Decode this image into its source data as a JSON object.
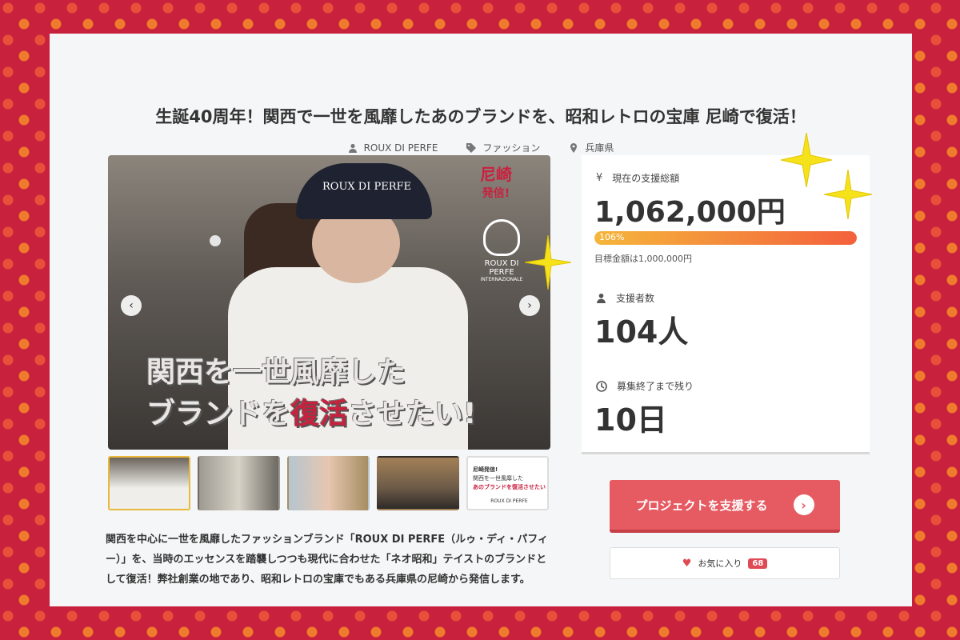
{
  "project": {
    "title": "生誕40周年！関西で一世を風靡したあのブランドを、昭和レトロの宝庫 尼崎で復活！",
    "meta": {
      "owner": "ROUX DI PERFE",
      "category": "ファッション",
      "location": "兵庫県"
    }
  },
  "hero": {
    "cap_text": "ROUX DI PERFE",
    "badge_line1": "尼崎",
    "badge_line2": "発信!",
    "logo_text": "ROUX DI PERFE",
    "logo_sub": "INTERNAZIONALE",
    "headline_line1": "関西を一世風靡した",
    "headline_line2_pre": "ブランドを",
    "headline_line2_accent": "復活",
    "headline_line2_post": "させたい!",
    "prev_arrow": "‹",
    "next_arrow": "›"
  },
  "thumbnails": [
    {
      "id": "thumb-1",
      "active": true
    },
    {
      "id": "thumb-2",
      "active": false
    },
    {
      "id": "thumb-3",
      "active": false
    },
    {
      "id": "thumb-4",
      "active": false
    },
    {
      "id": "thumb-5",
      "active": false,
      "text_line1": "尼崎発信!",
      "text_line2": "関西を一世風靡した",
      "text_line3": "あのブランドを復活させたい",
      "brand": "ROUX DI PERFE"
    }
  ],
  "description": "関西を中心に一世を風靡したファッションブランド「ROUX DI PERFE（ルゥ・ディ・パフィー）」を、当時のエッセンスを踏襲しつつも現代に合わせた「ネオ昭和」テイストのブランドとして復活！弊社創業の地であり、昭和レトロの宝庫でもある兵庫県の尼崎から発信します。",
  "stats": {
    "amount_label": "現在の支援総額",
    "amount_value": "1,062,000円",
    "progress_label": "106%",
    "progress_fraction": 1.0,
    "goal_text": "目標金額は1,000,000円",
    "supporters_label": "支援者数",
    "supporters_value": "104人",
    "remaining_label": "募集終了まで残り",
    "remaining_value": "10日"
  },
  "actions": {
    "support_label": "プロジェクトを支援する",
    "favorite_label": "お気に入り",
    "favorite_count": "68"
  },
  "colors": {
    "background": "#c8213e",
    "accent": "#e65a62",
    "progress_start": "#f5b63b",
    "progress_end": "#f4603c"
  }
}
